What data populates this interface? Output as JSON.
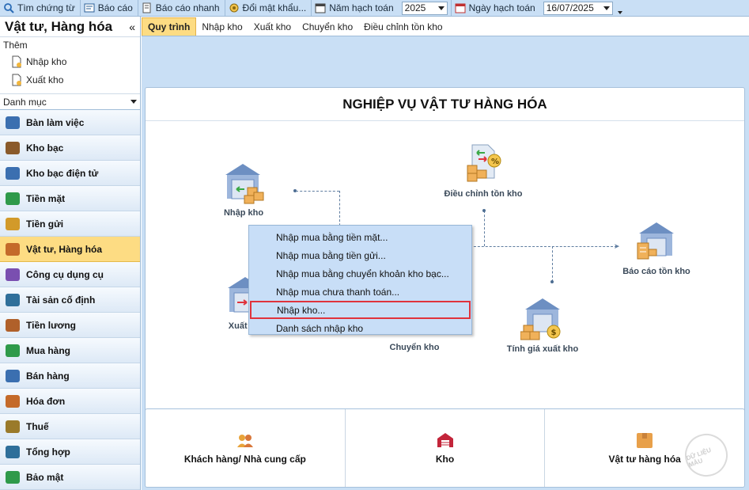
{
  "toolbar": {
    "items": [
      {
        "label": "Tìm chứng từ",
        "icon": "search-icon"
      },
      {
        "label": "Báo cáo",
        "icon": "report-icon"
      },
      {
        "label": "Báo cáo nhanh",
        "icon": "quick-report-icon"
      },
      {
        "label": "Đổi mật khẩu...",
        "icon": "change-password-icon"
      },
      {
        "label": "Năm hạch toán",
        "icon": "calendar-year-icon"
      }
    ],
    "year_value": "2025",
    "date_label": "Ngày hạch toán",
    "date_value": "16/07/2025"
  },
  "sidebar": {
    "title": "Vật tư, Hàng hóa",
    "collapse_glyph": "«",
    "add_label": "Thêm",
    "add_links": [
      "Nhập kho",
      "Xuất kho"
    ],
    "category_label": "Danh mục",
    "items": [
      {
        "label": "Bàn làm việc",
        "icon": "desk-icon"
      },
      {
        "label": "Kho bạc",
        "icon": "treasury-icon"
      },
      {
        "label": "Kho bạc điện tử",
        "icon": "e-treasury-icon"
      },
      {
        "label": "Tiền mặt",
        "icon": "cash-icon"
      },
      {
        "label": "Tiền gửi",
        "icon": "deposit-icon"
      },
      {
        "label": "Vật tư, Hàng hóa",
        "icon": "materials-icon",
        "active": true
      },
      {
        "label": "Công cụ dụng cụ",
        "icon": "tools-icon"
      },
      {
        "label": "Tài sản cố định",
        "icon": "fixed-assets-icon"
      },
      {
        "label": "Tiền lương",
        "icon": "salary-icon"
      },
      {
        "label": "Mua hàng",
        "icon": "purchase-icon"
      },
      {
        "label": "Bán hàng",
        "icon": "sales-icon"
      },
      {
        "label": "Hóa đơn",
        "icon": "invoice-icon"
      },
      {
        "label": "Thuế",
        "icon": "tax-icon"
      },
      {
        "label": "Tổng hợp",
        "icon": "summary-icon"
      },
      {
        "label": "Bảo mật",
        "icon": "security-icon"
      }
    ]
  },
  "tabs": [
    "Quy trình",
    "Nhập kho",
    "Xuất kho",
    "Chuyển kho",
    "Điều chỉnh tồn kho"
  ],
  "flow": {
    "title": "NGHIỆP VỤ VẬT TƯ HÀNG HÓA",
    "nodes": {
      "nhap_kho": "Nhập kho",
      "dieu_chinh": "Điều chỉnh tồn kho",
      "bao_cao": "Báo cáo tồn kho",
      "xuat_kho": "Xuất kho",
      "chuyen_kho": "Chuyển kho",
      "tinh_gia": "Tính giá xuất kho"
    }
  },
  "bottom": [
    {
      "label": "Khách hàng/ Nhà cung cấp",
      "icon": "customers-icon"
    },
    {
      "label": "Kho",
      "icon": "warehouse-icon"
    },
    {
      "label": "Vật tư hàng hóa",
      "icon": "box-icon"
    }
  ],
  "context_menu": {
    "items": [
      "Nhập mua bằng tiền mặt...",
      "Nhập mua bằng tiền gửi...",
      "Nhập mua bằng chuyển khoản kho bạc...",
      "Nhập mua chưa thanh toán...",
      "Nhập kho...",
      "Danh sách nhập kho"
    ],
    "highlighted_index": 4
  },
  "watermark": "DỮ LIỆU MẪU",
  "colors": {
    "accent_tab": "#fddc83",
    "toolbar": "#c9dff5",
    "highlight_border": "#e0333c"
  }
}
